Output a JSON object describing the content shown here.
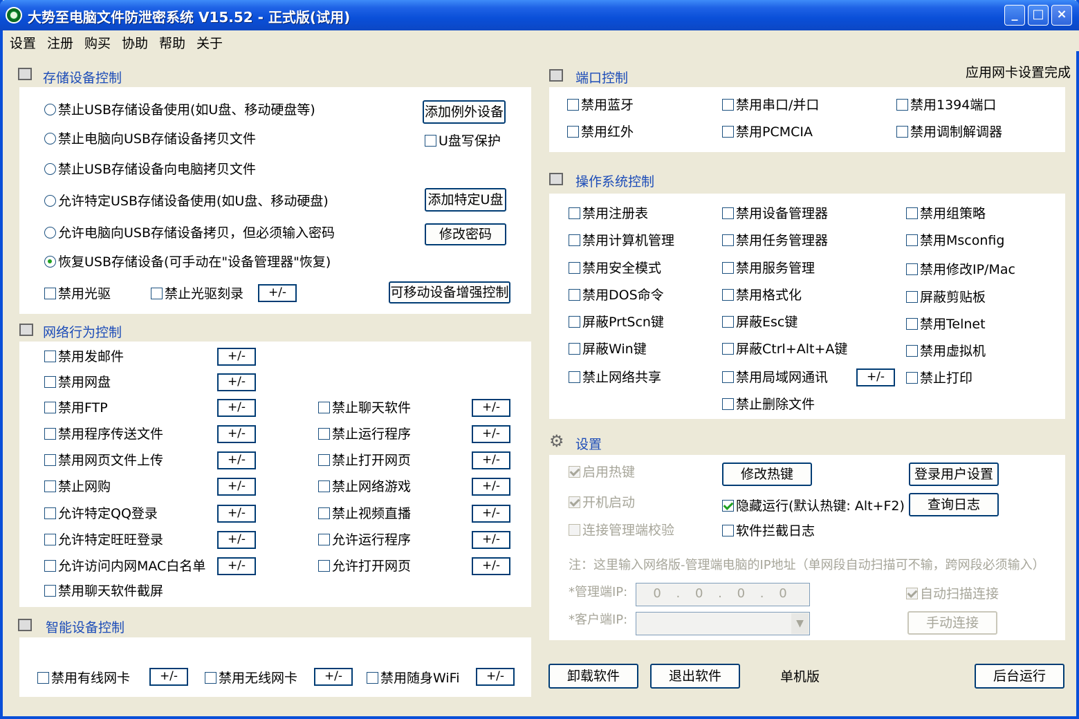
{
  "window": {
    "title": "大势至电脑文件防泄密系统 V15.52 - 正式版(试用)",
    "min": "_",
    "max": "□",
    "close": "×"
  },
  "menu": [
    "设置",
    "注册",
    "购买",
    "协助",
    "帮助",
    "关于"
  ],
  "storage": {
    "title": "存储设备控制",
    "radios": [
      {
        "label": "禁止USB存储设备使用(如U盘、移动硬盘等)",
        "checked": false
      },
      {
        "label": "禁止电脑向USB存储设备拷贝文件",
        "checked": false
      },
      {
        "label": "禁止USB存储设备向电脑拷贝文件",
        "checked": false
      },
      {
        "label": "允许特定USB存储设备使用(如U盘、移动硬盘)",
        "checked": false
      },
      {
        "label": "允许电脑向USB存储设备拷贝，但必须输入密码",
        "checked": false
      },
      {
        "label": "恢复USB存储设备(可手动在\"设备管理器\"恢复)",
        "checked": true
      }
    ],
    "add_exception": "添加例外设备",
    "usb_write_protect": "U盘写保护",
    "add_specific": "添加特定U盘",
    "change_pwd": "修改密码",
    "disable_cd": "禁用光驱",
    "disable_burn": "禁止光驱刻录",
    "pm": "+/-",
    "enhanced": "可移动设备增强控制"
  },
  "network": {
    "title": "网络行为控制",
    "left": [
      "禁用发邮件",
      "禁用网盘",
      "禁用FTP",
      "禁用程序传送文件",
      "禁用网页文件上传",
      "禁止网购",
      "允许特定QQ登录",
      "允许特定旺旺登录",
      "允许访问内网MAC白名单",
      "禁用聊天软件截屏"
    ],
    "right": [
      "禁止聊天软件",
      "禁止运行程序",
      "禁止打开网页",
      "禁止网络游戏",
      "禁止视频直播",
      "允许运行程序",
      "允许打开网页"
    ]
  },
  "smart": {
    "title": "智能设备控制",
    "items": [
      "禁用有线网卡",
      "禁用无线网卡",
      "禁用随身WiFi"
    ]
  },
  "port": {
    "title": "端口控制",
    "status": "应用网卡设置完成",
    "items": [
      "禁用蓝牙",
      "禁用串口/并口",
      "禁用1394端口",
      "禁用红外",
      "禁用PCMCIA",
      "禁用调制解调器"
    ]
  },
  "os": {
    "title": "操作系统控制",
    "col1": [
      "禁用注册表",
      "禁用计算机管理",
      "禁用安全模式",
      "禁用DOS命令",
      "屏蔽PrtScn键",
      "屏蔽Win键",
      "禁止网络共享"
    ],
    "col2": [
      "禁用设备管理器",
      "禁用任务管理器",
      "禁用服务管理",
      "禁用格式化",
      "屏蔽Esc键",
      "屏蔽Ctrl+Alt+A键",
      "禁用局域网通讯",
      "禁止删除文件"
    ],
    "col3": [
      "禁用组策略",
      "禁用Msconfig",
      "禁用修改IP/Mac",
      "屏蔽剪贴板",
      "禁用Telnet",
      "禁用虚拟机",
      "禁止打印"
    ]
  },
  "settings": {
    "title": "设置",
    "hotkey": "启用热键",
    "boot": "开机启动",
    "verify": "连接管理端校验",
    "modify_hotkey": "修改热键",
    "hide_run": "隐藏运行(默认热键: Alt+F2)",
    "intercept_log": "软件拦截日志",
    "login_settings": "登录用户设置",
    "query_log": "查询日志",
    "note": "注：这里输入网络版-管理端电脑的IP地址（单网段自动扫描可不输，跨网段必须输入）",
    "mgr_ip_label": "*管理端IP:",
    "mgr_ip": "0 . 0 . 0 . 0",
    "client_ip_label": "*客户端IP:",
    "auto_scan": "自动扫描连接",
    "manual_connect": "手动连接"
  },
  "bottom": {
    "uninstall": "卸载软件",
    "exit": "退出软件",
    "mode": "单机版",
    "background": "后台运行"
  }
}
